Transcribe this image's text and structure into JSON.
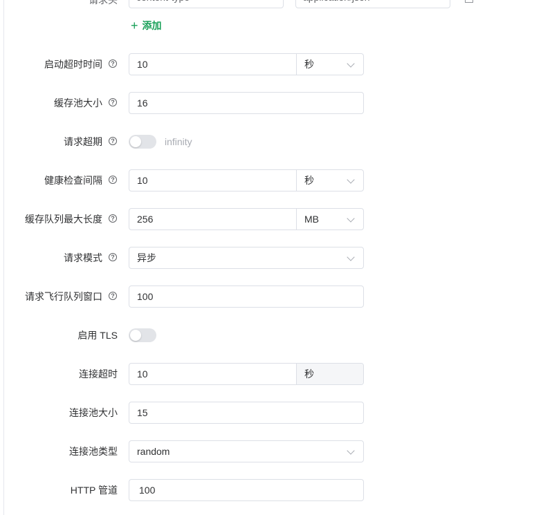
{
  "header_row": {
    "label": "请求头",
    "key_value": "content-type",
    "value_value": "application/json"
  },
  "add_label": "添加",
  "fields": {
    "startup_timeout": {
      "label": "启动超时时间",
      "value": "10",
      "unit": "秒"
    },
    "cache_pool_size": {
      "label": "缓存池大小",
      "value": "16"
    },
    "request_timeout": {
      "label": "请求超期",
      "switch_on": false,
      "switch_text": "infinity"
    },
    "health_check_interval": {
      "label": "健康检查间隔",
      "value": "10",
      "unit": "秒"
    },
    "cache_queue_max_length": {
      "label": "缓存队列最大长度",
      "value": "256",
      "unit": "MB"
    },
    "request_mode": {
      "label": "请求模式",
      "value": "异步"
    },
    "inflight_queue_window": {
      "label": "请求飞行队列窗口",
      "value": "100"
    },
    "enable_tls": {
      "label": "启用 TLS",
      "switch_on": false
    },
    "connect_timeout": {
      "label": "连接超时",
      "value": "10",
      "unit": "秒"
    },
    "connection_pool_size": {
      "label": "连接池大小",
      "value": "15"
    },
    "connection_pool_type": {
      "label": "连接池类型",
      "value": "random"
    },
    "http_pipeline": {
      "label": "HTTP 管道",
      "value": "100"
    }
  },
  "colors": {
    "accent": "#18a058",
    "border": "#dcdfe6",
    "switch_off": "#e2e4e8"
  },
  "icons": {
    "help": "question-circle-icon",
    "dropdown": "chevron-down-icon",
    "add": "plus-icon",
    "delete": "trash-icon"
  }
}
